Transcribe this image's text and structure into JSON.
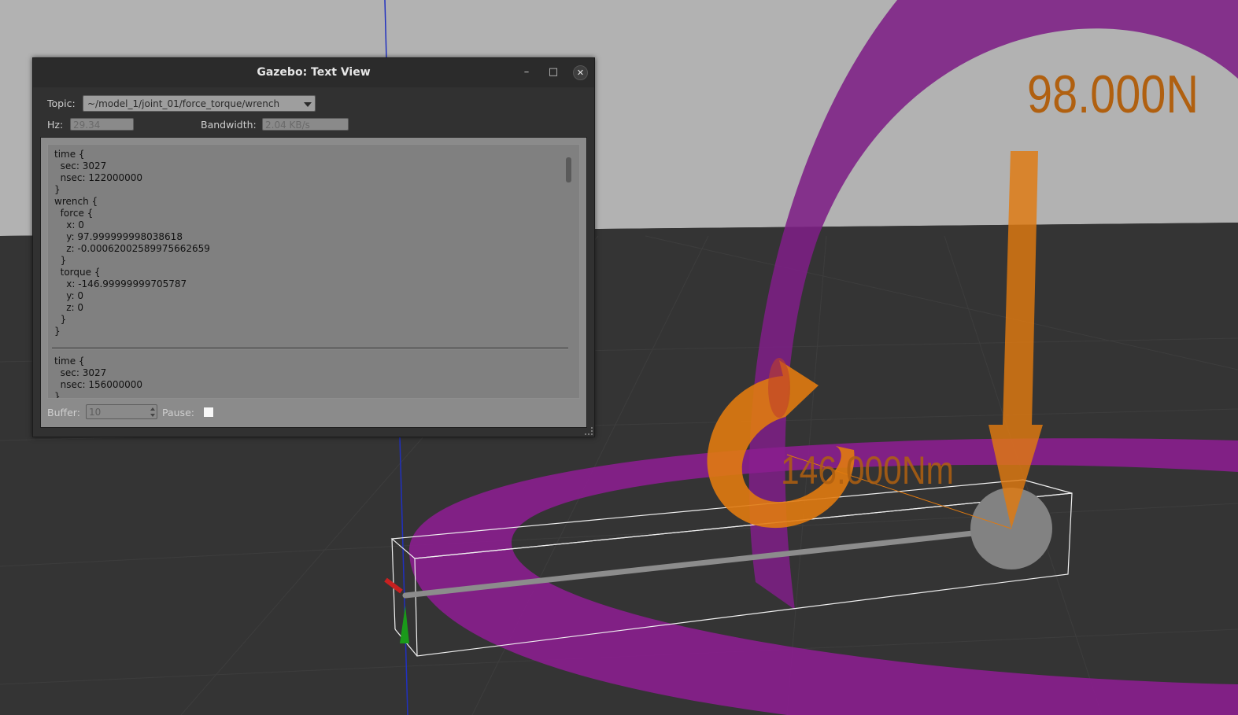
{
  "window": {
    "title": "Gazebo: Text View",
    "minimize_glyph": "–",
    "maximize_glyph": "□",
    "close_glyph": "✕"
  },
  "topic": {
    "label": "Topic:",
    "value": "~/model_1/joint_01/force_torque/wrench"
  },
  "hz": {
    "label": "Hz:",
    "value": "29.34"
  },
  "bandwidth": {
    "label": "Bandwidth:",
    "value": "2.04 KB/s"
  },
  "messages": [
    "time {\n  sec: 3027\n  nsec: 122000000\n}\nwrench {\n  force {\n    x: 0\n    y: 97.999999998038618\n    z: -0.00062002589975662659\n  }\n  torque {\n    x: -146.99999999705787\n    y: 0\n    z: 0\n  }\n}",
    "time {\n  sec: 3027\n  nsec: 156000000\n}"
  ],
  "buffer": {
    "label": "Buffer:",
    "value": "10"
  },
  "pause": {
    "label": "Pause:",
    "checked": false
  },
  "scene": {
    "force_label": "98.000N",
    "torque_label": "146.000Nm",
    "colors": {
      "ring": "#8a1e8e",
      "arrow": "#e07a10",
      "ground": "#343434",
      "sky": "#b2b2b2"
    }
  }
}
